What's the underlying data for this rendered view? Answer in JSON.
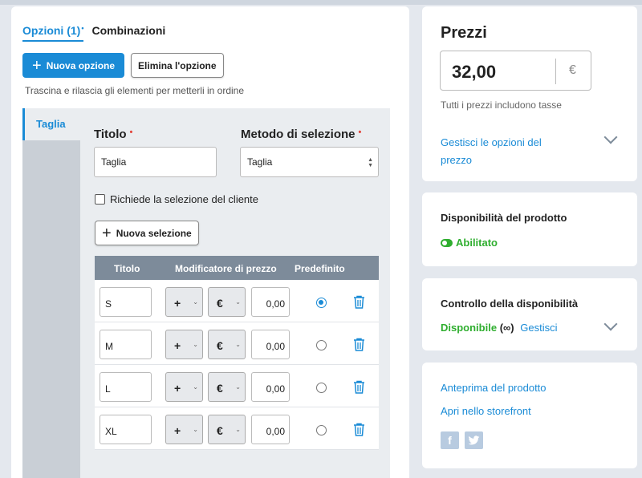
{
  "tabs": [
    {
      "label": "Opzioni (1)",
      "marker": "•"
    },
    {
      "label": "Combinazioni"
    }
  ],
  "toolbar": {
    "new_option_label": "Nuova opzione",
    "delete_option_label": "Elimina l'opzione",
    "hint": "Trascina e rilascia gli elementi per metterli in ordine"
  },
  "option_list": {
    "items": [
      {
        "label": "Taglia"
      }
    ]
  },
  "option_form": {
    "title_label": "Titolo",
    "title_value": "Taglia",
    "required_marker": "•",
    "method_label": "Metodo di selezione",
    "method_value": "Taglia",
    "requires_selection_label": "Richiede la selezione del cliente",
    "requires_selection_checked": false,
    "new_selection_label": "Nuova selezione"
  },
  "table": {
    "headers": [
      "Titolo",
      "Modificatore di prezzo",
      "Predefinito"
    ],
    "rows": [
      {
        "title": "S",
        "sign": "+",
        "currency": "€",
        "amount": "0,00",
        "default": true
      },
      {
        "title": "M",
        "sign": "+",
        "currency": "€",
        "amount": "0,00",
        "default": false
      },
      {
        "title": "L",
        "sign": "+",
        "currency": "€",
        "amount": "0,00",
        "default": false
      },
      {
        "title": "XL",
        "sign": "+",
        "currency": "€",
        "amount": "0,00",
        "default": false
      }
    ]
  },
  "prices": {
    "title": "Prezzi",
    "value": "32,00",
    "currency": "€",
    "tax_note": "Tutti i prezzi includono tasse",
    "manage_link_line1": "Gestisci le opzioni del",
    "manage_link_line2": "prezzo"
  },
  "availability": {
    "title": "Disponibilità del prodotto",
    "status": "Abilitato"
  },
  "stock": {
    "title": "Controllo della disponibilità",
    "status": "Disponibile",
    "infinity": "(∞)",
    "manage_link": "Gestisci"
  },
  "links": {
    "preview": "Anteprima del prodotto",
    "storefront": "Apri nello storefront",
    "facebook": "f"
  },
  "colors": {
    "accent": "#1a8bd6",
    "success": "#2fae2f",
    "table_header": "#7d8b9a",
    "required": "#e2443a"
  }
}
